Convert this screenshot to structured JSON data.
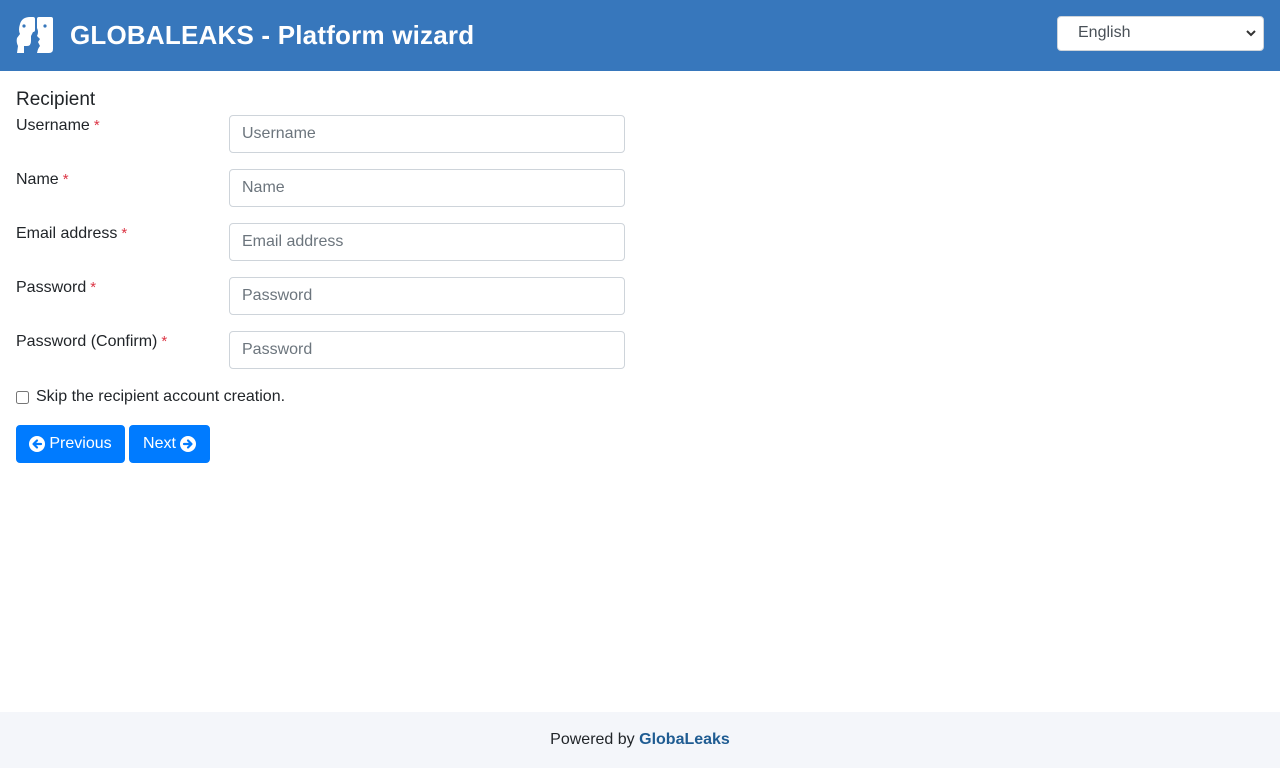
{
  "header": {
    "title": "GLOBALEAKS - Platform wizard",
    "language": "English",
    "background_color": "#3777bc"
  },
  "section": {
    "title": "Recipient"
  },
  "fields": [
    {
      "label": "Username",
      "required": "*",
      "placeholder": "Username",
      "value": ""
    },
    {
      "label": "Name",
      "required": "*",
      "placeholder": "Name",
      "value": ""
    },
    {
      "label": "Email address",
      "required": "*",
      "placeholder": "Email address",
      "value": ""
    },
    {
      "label": "Password",
      "required": "*",
      "placeholder": "Password",
      "value": ""
    },
    {
      "label": "Password (Confirm)",
      "required": "*",
      "placeholder": "Password",
      "value": ""
    }
  ],
  "skip": {
    "label": "Skip the recipient account creation.",
    "checked": false
  },
  "buttons": {
    "previous": "Previous",
    "next": "Next",
    "color": "#007bff"
  },
  "footer": {
    "prefix": "Powered by",
    "link": "GlobaLeaks"
  },
  "icons": {
    "logo": "globaleaks-logo-icon",
    "previous": "arrow-circle-left-icon",
    "next": "arrow-circle-right-icon",
    "select": "chevron-down-icon"
  }
}
